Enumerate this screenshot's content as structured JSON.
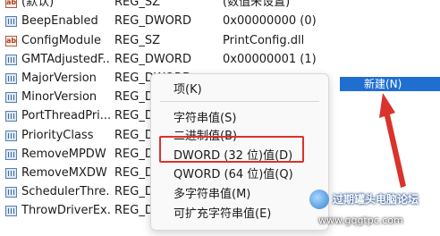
{
  "rows": [
    {
      "icon": "string-value-icon",
      "name": "(默认)",
      "type": "REG_SZ",
      "data": "(数值未设置)"
    },
    {
      "icon": "binary-value-icon",
      "name": "BeepEnabled",
      "type": "REG_DWORD",
      "data": "0x00000000 (0)"
    },
    {
      "icon": "string-value-icon",
      "name": "ConfigModule",
      "type": "REG_SZ",
      "data": "PrintConfig.dll"
    },
    {
      "icon": "binary-value-icon",
      "name": "GMTAdjustedF...",
      "type": "REG_DWORD",
      "data": "0x00000001 (1)"
    },
    {
      "icon": "binary-value-icon",
      "name": "MajorVersion",
      "type": "REG_DWORD",
      "data": ""
    },
    {
      "icon": "binary-value-icon",
      "name": "MinorVersion",
      "type": "REG_DWORD",
      "data": ""
    },
    {
      "icon": "binary-value-icon",
      "name": "PortThreadPri...",
      "type": "REG_DWORD",
      "data": ""
    },
    {
      "icon": "binary-value-icon",
      "name": "PriorityClass",
      "type": "REG_DWORD",
      "data": ""
    },
    {
      "icon": "binary-value-icon",
      "name": "RemoveMPDW",
      "type": "REG_DWORD",
      "data": ""
    },
    {
      "icon": "binary-value-icon",
      "name": "RemoveMXDW",
      "type": "REG_DWORD",
      "data": ""
    },
    {
      "icon": "binary-value-icon",
      "name": "SchedulerThre...",
      "type": "REG_DWORD",
      "data": ""
    },
    {
      "icon": "binary-value-icon",
      "name": "ThrowDriverEx...",
      "type": "REG_DWORD",
      "data": ""
    }
  ],
  "parent_menu": {
    "new_label": "新建(N)"
  },
  "context_menu": {
    "items": [
      "项(K)",
      "字符串值(S)",
      "二进制值(B)",
      "DWORD (32 位)值(D)",
      "QWORD (64 位)值(Q)",
      "多字符串值(M)",
      "可扩充字符串值(E)"
    ]
  },
  "colors": {
    "highlight_box": "#d9332b",
    "selected_item": "#1f6fd1",
    "arrow": "#d9332b"
  },
  "watermark": {
    "title": "过期罐头电脑论坛",
    "url": "www.gqgtpc.com"
  }
}
